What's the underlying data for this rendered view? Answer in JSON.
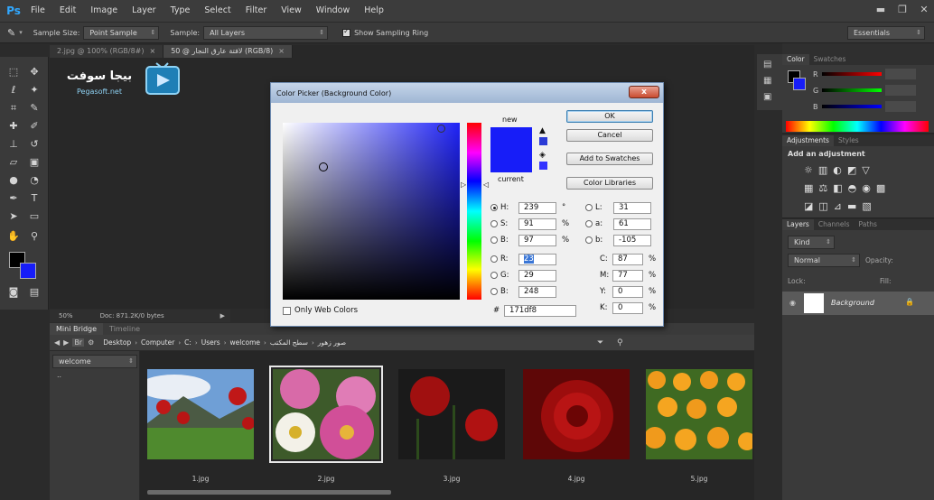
{
  "menubar": {
    "logo": "Ps",
    "items": [
      "File",
      "Edit",
      "Image",
      "Layer",
      "Type",
      "Select",
      "Filter",
      "View",
      "Window",
      "Help"
    ]
  },
  "options": {
    "sample_size_label": "Sample Size:",
    "sample_size_value": "Point Sample",
    "sample_label": "Sample:",
    "sample_value": "All Layers",
    "show_ring_label": "Show Sampling Ring",
    "workspace": "Essentials"
  },
  "tabs": [
    {
      "label": "2.jpg @ 100% (RGB/8#)",
      "active": false
    },
    {
      "label": "50 @ لافتة عارق النجار (RGB/8)",
      "active": true
    }
  ],
  "watermark": {
    "name": "بيجا سوفت",
    "url": "Pegasoft.net"
  },
  "doc_status": {
    "zoom": "50%",
    "info": "Doc: 871.2K/0 bytes"
  },
  "dialog": {
    "title": "Color Picker (Background Color)",
    "close": "x",
    "new_label": "new",
    "current_label": "current",
    "ok": "OK",
    "cancel": "Cancel",
    "add_swatches": "Add to Swatches",
    "color_libraries": "Color Libraries",
    "only_web": "Only Web Colors",
    "hex_prefix": "#",
    "hex": "171df8",
    "fields": {
      "H": {
        "label": "H:",
        "value": "239",
        "unit": "°"
      },
      "S": {
        "label": "S:",
        "value": "91",
        "unit": "%"
      },
      "B": {
        "label": "B:",
        "value": "97",
        "unit": "%"
      },
      "R": {
        "label": "R:",
        "value": "23",
        "unit": ""
      },
      "G": {
        "label": "G:",
        "value": "29",
        "unit": ""
      },
      "Bl": {
        "label": "B:",
        "value": "248",
        "unit": ""
      },
      "L": {
        "label": "L:",
        "value": "31",
        "unit": ""
      },
      "a": {
        "label": "a:",
        "value": "61",
        "unit": ""
      },
      "b": {
        "label": "b:",
        "value": "-105",
        "unit": ""
      },
      "C": {
        "label": "C:",
        "value": "87",
        "unit": "%"
      },
      "M": {
        "label": "M:",
        "value": "77",
        "unit": "%"
      },
      "Y": {
        "label": "Y:",
        "value": "0",
        "unit": "%"
      },
      "K": {
        "label": "K:",
        "value": "0",
        "unit": "%"
      }
    },
    "new_color": "#171df8"
  },
  "bridge": {
    "tabs": [
      "Mini Bridge",
      "Timeline"
    ],
    "path": [
      "Desktop",
      "Computer",
      "C:",
      "Users",
      "welcome",
      "سطح المكتب",
      "صور زهور"
    ],
    "folder": "welcome",
    "up_item": "..",
    "files": [
      "1.jpg",
      "2.jpg",
      "3.jpg",
      "4.jpg",
      "5.jpg"
    ]
  },
  "panels": {
    "color_tabs": [
      "Color",
      "Swatches"
    ],
    "rgb_labels": [
      "R",
      "G",
      "B"
    ],
    "adj_tabs": [
      "Adjustments",
      "Styles"
    ],
    "adj_title": "Add an adjustment",
    "layers_tabs": [
      "Layers",
      "Channels",
      "Paths"
    ],
    "kind": "Kind",
    "blend": "Normal",
    "opacity_label": "Opacity:",
    "lock_label": "Lock:",
    "fill_label": "Fill:",
    "layer_name": "Background"
  }
}
